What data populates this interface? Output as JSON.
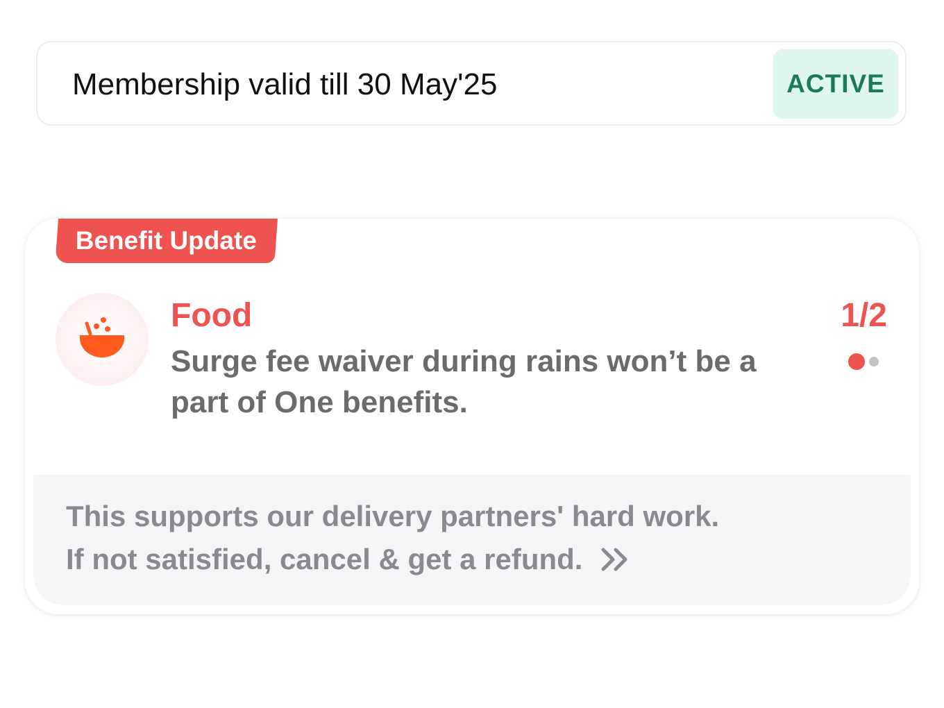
{
  "membership": {
    "validity_text": "Membership valid till 30 May'25",
    "status_label": "ACTIVE"
  },
  "benefit_update": {
    "tag_label": "Benefit Update",
    "icon": "food-bowl-icon",
    "category": "Food",
    "description": "Surge fee waiver during rains won’t be a part of One benefits.",
    "pager": {
      "label": "1/2",
      "current": 1,
      "total": 2
    },
    "footer": {
      "line1": "This supports our delivery partners' hard work.",
      "line2": "If not satisfied, cancel & get a refund.",
      "link_icon": "double-chevron-right-icon"
    }
  },
  "colors": {
    "accent": "#ef5350",
    "icon_orange": "#ff5a1f",
    "active_bg": "#dff7ee",
    "active_text": "#1b7a5c",
    "dot_inactive": "#c4c4c4",
    "icon_circle": "#fdeef0"
  }
}
